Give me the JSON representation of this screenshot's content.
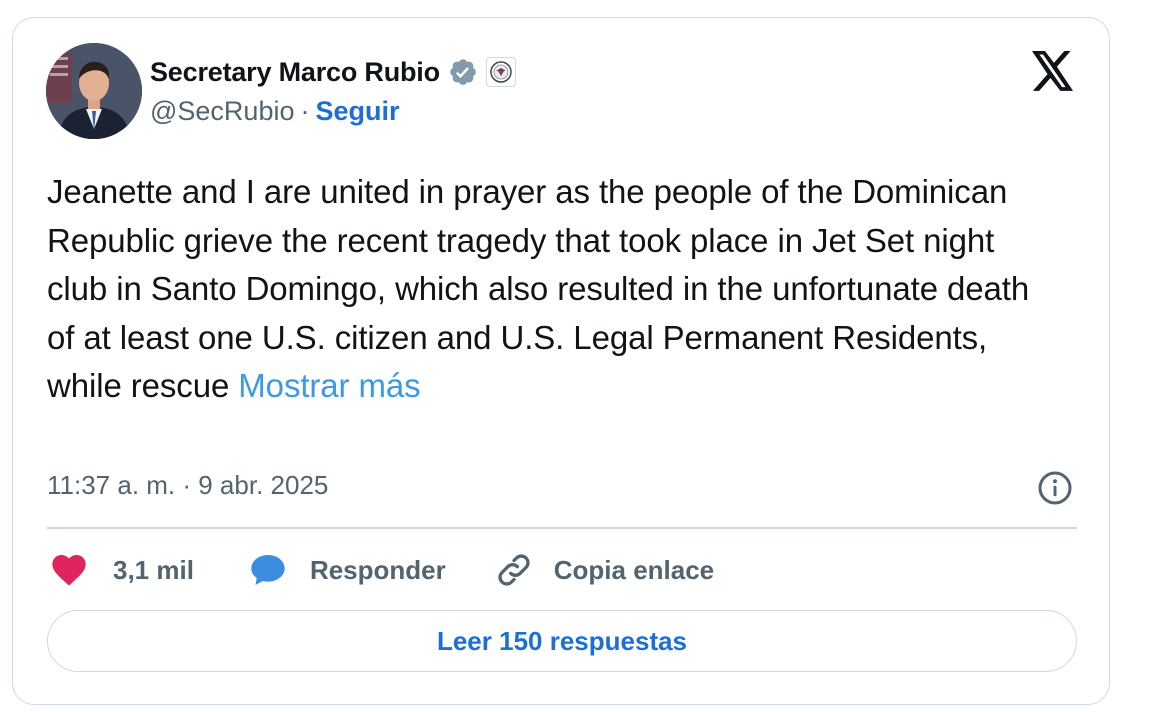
{
  "author": {
    "name": "Secretary Marco Rubio",
    "handle": "@SecRubio",
    "separator": "·",
    "follow_label": "Seguir"
  },
  "tweet": {
    "text": "Jeanette and I are united in prayer as the people of the Dominican Republic grieve the recent tragedy that took place in Jet Set night club in Santo Domingo, which also resulted in the unfortunate death of at least one U.S. citizen and U.S. Legal Permanent Residents, while rescue ",
    "show_more": "Mostrar más",
    "timestamp": "11:37 a. m. · 9 abr. 2025"
  },
  "actions": {
    "likes": "3,1 mil",
    "reply": "Responder",
    "copy_link": "Copia enlace"
  },
  "read_replies": "Leer 150 respuestas",
  "icons": {
    "brand": "x-logo-icon",
    "verified": "verified-badge-icon",
    "affiliation": "state-department-seal-icon",
    "info": "info-icon",
    "like": "heart-icon",
    "reply": "chat-bubble-icon",
    "copy": "link-icon"
  },
  "colors": {
    "accent": "#1d6fd8",
    "show_more": "#3b99e6",
    "heart": "#e0245e",
    "bubble": "#3b8de0",
    "muted": "#536471",
    "border": "#cfd9de"
  }
}
